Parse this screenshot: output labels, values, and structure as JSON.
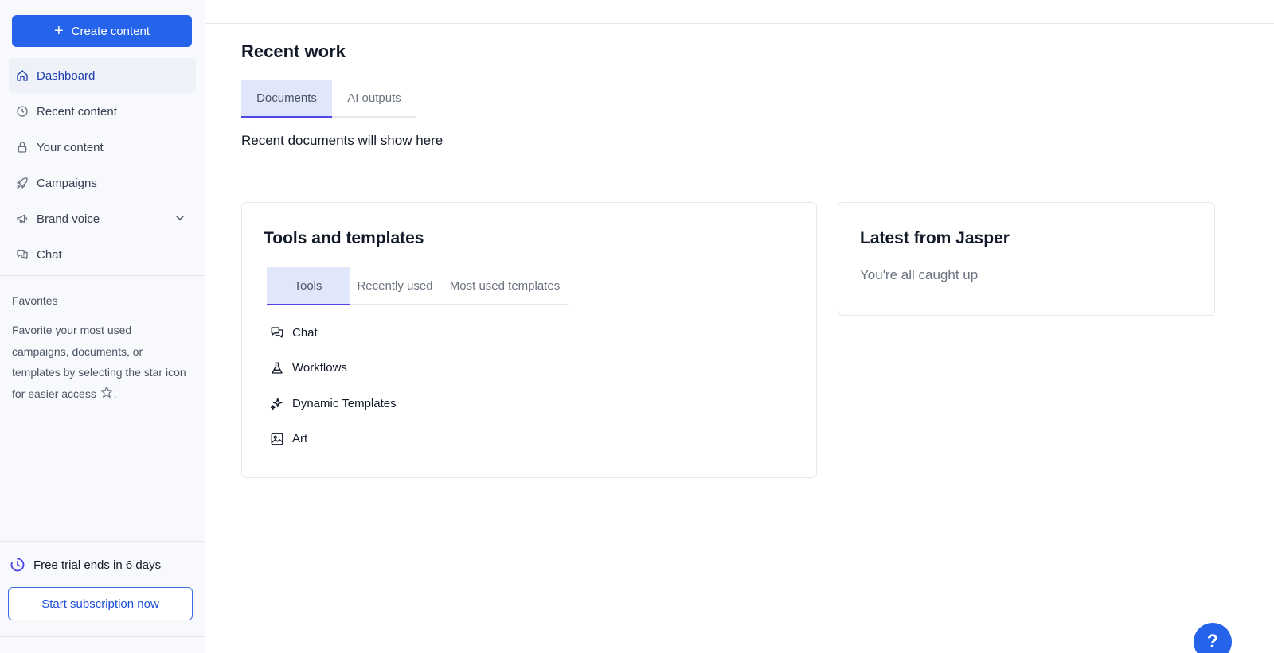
{
  "sidebar": {
    "create_label": "Create content",
    "nav": [
      {
        "label": "Dashboard",
        "icon": "home-icon"
      },
      {
        "label": "Recent content",
        "icon": "clock-icon"
      },
      {
        "label": "Your content",
        "icon": "lock-icon"
      },
      {
        "label": "Campaigns",
        "icon": "rocket-icon"
      },
      {
        "label": "Brand voice",
        "icon": "megaphone-icon"
      },
      {
        "label": "Chat",
        "icon": "chat-icon"
      }
    ],
    "favorites_title": "Favorites",
    "favorites_text_before": "Favorite your most used campaigns, documents, or templates by selecting the star icon for easier access",
    "favorites_text_after": ".",
    "trial_text": "Free trial ends in 6 days",
    "subscribe_label": "Start subscription now"
  },
  "recent": {
    "title": "Recent work",
    "tabs": [
      "Documents",
      "AI outputs"
    ],
    "active_tab": "Documents",
    "empty_text": "Recent documents will show here"
  },
  "tools": {
    "title": "Tools and templates",
    "tabs": [
      "Tools",
      "Recently used",
      "Most used templates"
    ],
    "active_tab": "Tools",
    "items": [
      {
        "label": "Chat",
        "icon": "chat-icon"
      },
      {
        "label": "Workflows",
        "icon": "flask-icon"
      },
      {
        "label": "Dynamic Templates",
        "icon": "sparkle-icon"
      },
      {
        "label": "Art",
        "icon": "image-icon"
      }
    ]
  },
  "jasper": {
    "title": "Latest from Jasper",
    "subtitle": "You're all caught up"
  },
  "help": {
    "label": "?"
  },
  "colors": {
    "primary": "#2563eb",
    "tab_active_bg": "#e0e7fb",
    "tab_indicator": "#4f46e5",
    "sidebar_bg": "#f7f9fd"
  }
}
